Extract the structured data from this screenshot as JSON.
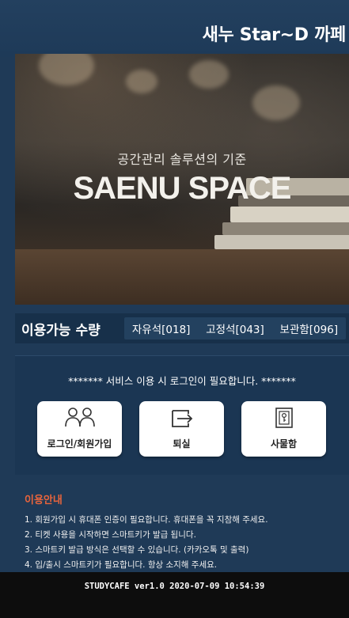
{
  "header": {
    "title": "새누 Star~D 까페"
  },
  "hero": {
    "tagline": "공간관리 솔루션의 기준",
    "brand": "SAENU SPACE"
  },
  "capacity": {
    "label": "이용가능 수량",
    "free_seat": "자유석[018]",
    "fixed_seat": "고정석[043]",
    "locker": "보관함[096]"
  },
  "panel": {
    "notice": "******* 서비스 이용 시 로그인이 필요합니다. *******",
    "login_label": "로그인/회원가입",
    "checkout_label": "퇴실",
    "locker_label": "사물함"
  },
  "guide": {
    "title": "이용안내",
    "lines": [
      "1. 회원가입 시 휴대폰 인증이 필요합니다. 휴대폰을 꼭 지참해 주세요.",
      "2. 티켓 사용을 시작하면 스마트키가 발급 됩니다.",
      "3. 스마트키 발급 방식은 선택할 수 있습니다. (카카오톡 및 출력)",
      "4. 입/출시 스마트키가 필요합니다. 항상 소지해 주세요."
    ]
  },
  "footer": {
    "version": "STUDYCAFE  ver1.0  2020-07-09  10:54:39"
  },
  "icons": {
    "login": "users-icon",
    "checkout": "exit-icon",
    "locker": "key-locker-icon"
  }
}
